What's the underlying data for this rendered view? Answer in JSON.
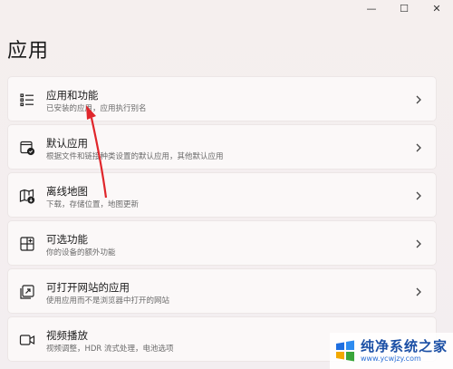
{
  "window": {
    "minimize_label": "—",
    "maximize_label": "☐",
    "close_label": "✕"
  },
  "page_title": "应用",
  "items": [
    {
      "title": "应用和功能",
      "subtitle": "已安装的应用，应用执行别名",
      "icon": "apps-list-icon"
    },
    {
      "title": "默认应用",
      "subtitle": "根据文件和链接种类设置的默认应用，其他默认应用",
      "icon": "default-apps-icon"
    },
    {
      "title": "离线地图",
      "subtitle": "下载，存储位置，地图更新",
      "icon": "offline-maps-icon"
    },
    {
      "title": "可选功能",
      "subtitle": "你的设备的额外功能",
      "icon": "optional-features-icon"
    },
    {
      "title": "可打开网站的应用",
      "subtitle": "使用应用而不是浏览器中打开的网站",
      "icon": "apps-for-websites-icon"
    },
    {
      "title": "视频播放",
      "subtitle": "视频调整，HDR 流式处理，电池选项",
      "icon": "video-playback-icon"
    }
  ],
  "annotation": {
    "arrow_color": "#e0262b"
  },
  "watermark": {
    "name": "纯净系统之家",
    "url": "www.ycwjzy.com",
    "icon": "watermark-logo"
  }
}
